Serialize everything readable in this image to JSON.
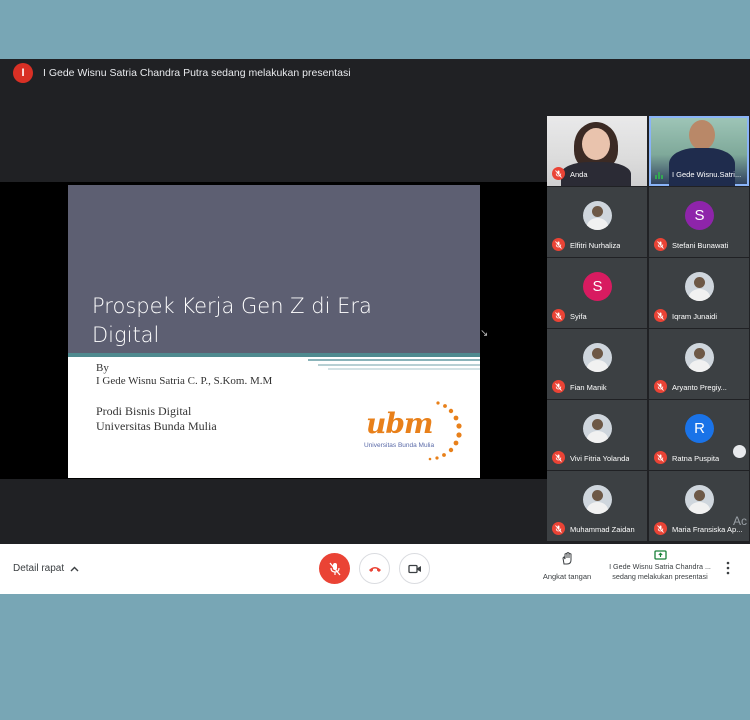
{
  "banner": {
    "avatar_letter": "I",
    "text": "I Gede Wisnu Satria Chandra Putra sedang melakukan presentasi"
  },
  "slide": {
    "title_line1": "Prospek Kerja Gen Z di Era",
    "title_line2": "Digital",
    "by": "By",
    "author": "I Gede Wisnu Satria C. P., S.Kom. M.M",
    "prodi": "Prodi Bisnis Digital",
    "university": "Universitas Bunda Mulia",
    "logo_text": "ubm",
    "logo_subtext": "Universitas Bunda Mulia"
  },
  "participants": [
    {
      "name": "Anda",
      "muted": true,
      "kind": "video-self"
    },
    {
      "name": "I Gede Wisnu.Satri...",
      "muted": false,
      "kind": "video-pres",
      "speaking": true
    },
    {
      "name": "Elfitri Nurhaliza",
      "muted": true,
      "kind": "photo"
    },
    {
      "name": "Stefani Bunawati",
      "muted": true,
      "kind": "letter",
      "letter": "S",
      "color": "#8e24aa"
    },
    {
      "name": "Syifa",
      "muted": true,
      "kind": "letter",
      "letter": "S",
      "color": "#d81b60"
    },
    {
      "name": "Iqram Junaidi",
      "muted": true,
      "kind": "photo"
    },
    {
      "name": "Fian Manik",
      "muted": true,
      "kind": "photo"
    },
    {
      "name": "Aryanto Pregiy...",
      "muted": true,
      "kind": "photo"
    },
    {
      "name": "Vivi Fitria Yolanda",
      "muted": true,
      "kind": "photo"
    },
    {
      "name": "Ratna Puspita",
      "muted": true,
      "kind": "letter",
      "letter": "R",
      "color": "#1a73e8"
    },
    {
      "name": "Muhammad Zaidan",
      "muted": true,
      "kind": "photo"
    },
    {
      "name": "Maria Fransiska Ap...",
      "muted": true,
      "kind": "photo"
    }
  ],
  "watermark": "Ac",
  "bottombar": {
    "meeting_details": "Detail rapat",
    "raise_hand": "Angkat tangan",
    "presenting_line1": "I Gede Wisnu Satria Chandra ...",
    "presenting_line2": "sedang melakukan presentasi"
  },
  "colors": {
    "accent_red": "#ea4335",
    "slide_header": "#5d5f72",
    "logo_orange": "#e8801a"
  }
}
